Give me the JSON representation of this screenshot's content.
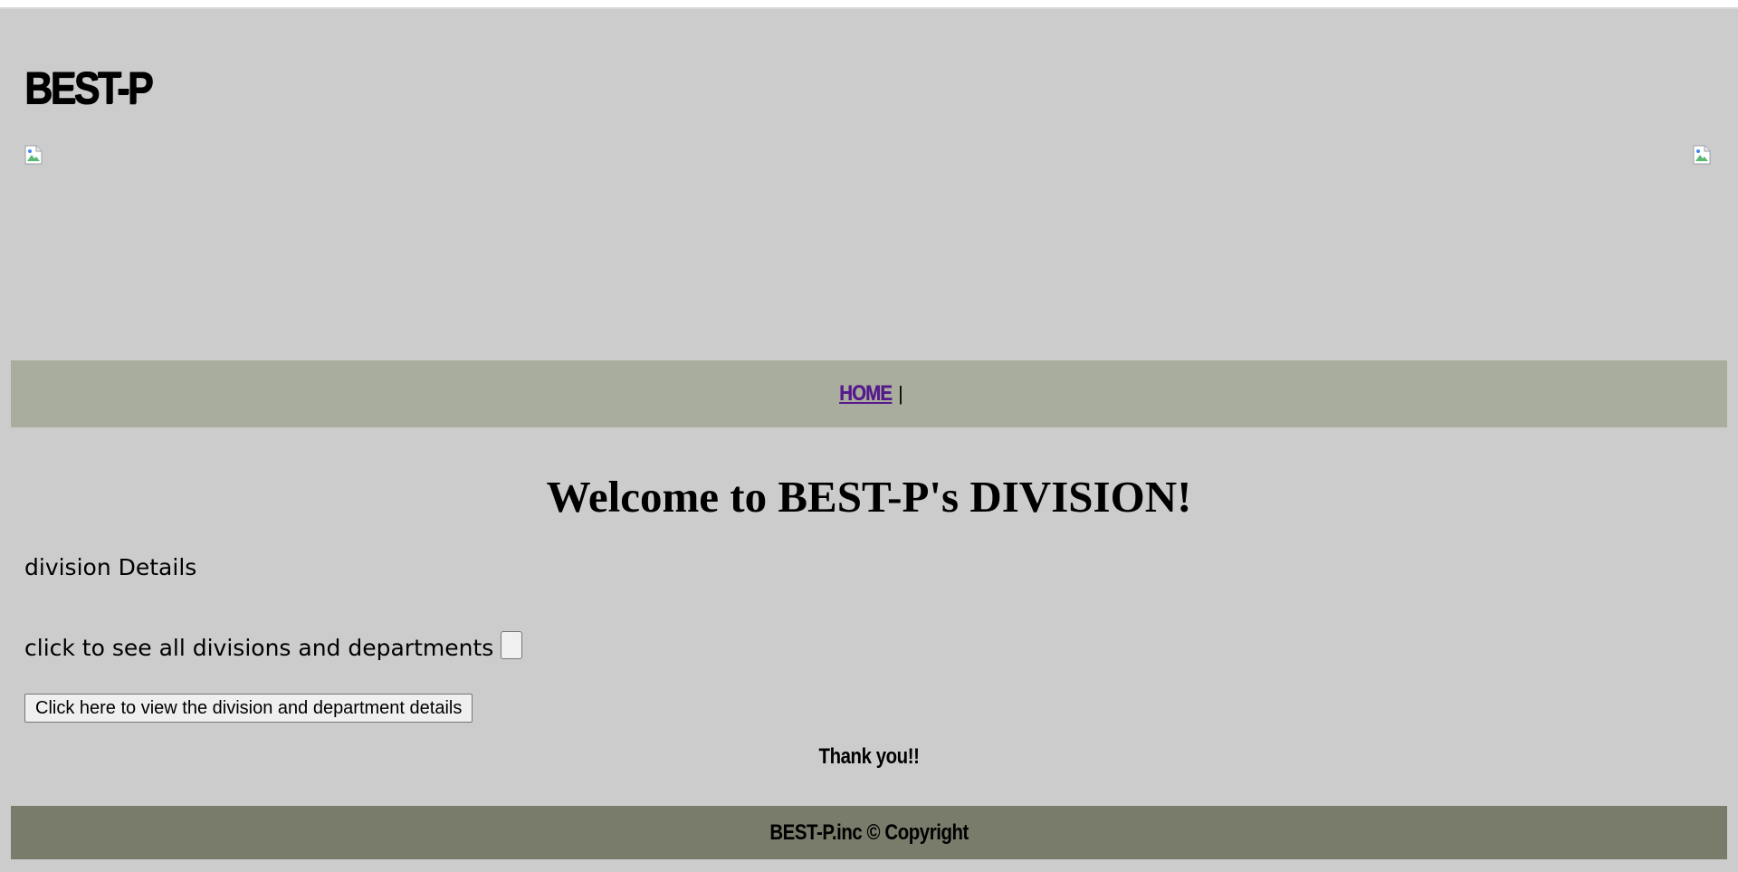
{
  "header": {
    "brand": "BEST-P"
  },
  "nav": {
    "home_link": "HOME",
    "separator": "|"
  },
  "main": {
    "welcome_heading": "Welcome to BEST-P's DIVISION!",
    "details_label": "division Details",
    "see_all_label": "click to see all divisions and departments",
    "view_button": "Click here to view the division and department details",
    "thanks": "Thank you!!"
  },
  "footer": {
    "copyright": "BEST-P.inc © Copyright"
  },
  "colors": {
    "page_bg": "#cccccc",
    "nav_bg": "#a9ad9d",
    "footer_bg": "#797c6b",
    "link": "#551a8b"
  }
}
